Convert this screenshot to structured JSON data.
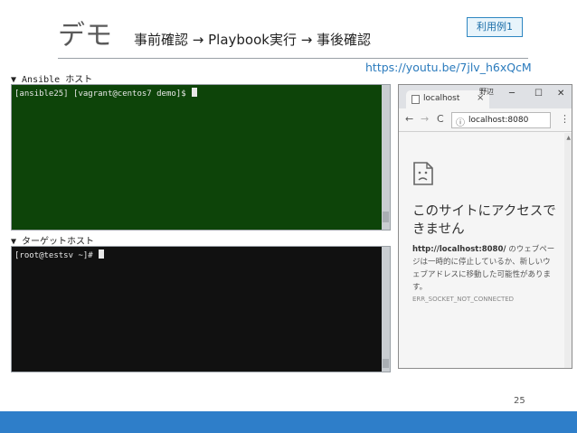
{
  "slide": {
    "title": "デモ",
    "subtitle": "事前確認 → Playbook実行 → 事後確認",
    "badge": "利用例1",
    "video_link": "https://youtu.be/7jlv_h6xQcM",
    "page_number": "25"
  },
  "sections": {
    "ansible_host_label": "▼ Ansible ホスト",
    "target_host_label": "▼ ターゲットホスト"
  },
  "terminals": {
    "ansible_prompt": "[ansible25] [vagrant@centos7 demo]$ ",
    "target_prompt": "[root@testsv ~]# "
  },
  "browser": {
    "tab_title": "localhost",
    "tab_close": "×",
    "profile_label": "野辺",
    "window_minimize": "─",
    "window_maximize": "☐",
    "window_close": "✕",
    "nav_back": "←",
    "nav_forward": "→",
    "nav_reload": "C",
    "info_icon": "ⓘ",
    "url": "localhost:8080",
    "menu_icon": "⋮",
    "error_heading": "このサイトにアクセスできません",
    "error_url": "http://localhost:8080/",
    "error_message": " のウェブページは一時的に停止しているか、新しいウェブアドレスに移動した可能性があります。",
    "error_code": "ERR_SOCKET_NOT_CONNECTED"
  },
  "colors": {
    "accent_blue": "#2e7ec9",
    "ansible_terminal_bg": "#0d4409",
    "target_terminal_bg": "#111111"
  }
}
